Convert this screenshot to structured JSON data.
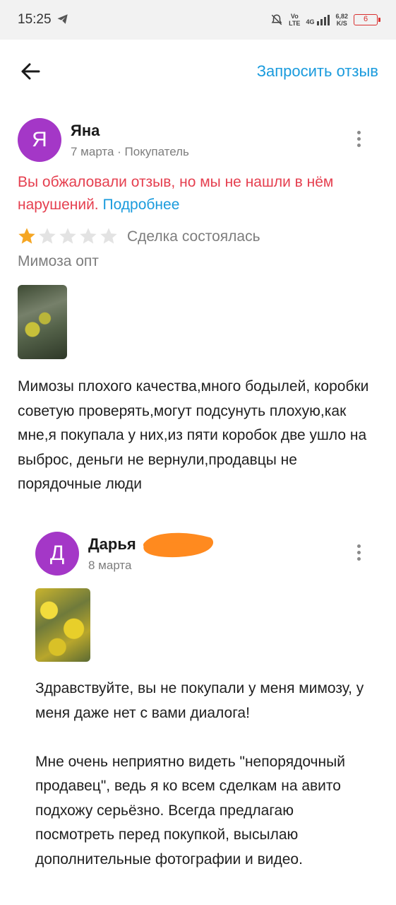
{
  "status_bar": {
    "time": "15:25",
    "icons": [
      "telegram-icon",
      "mute-icon",
      "volte-icon",
      "4g-signal-icon"
    ],
    "volte_label": [
      "Vo",
      "LTE"
    ],
    "network": "4G",
    "speed_value": "6,82",
    "speed_unit": "K/S",
    "battery": "6",
    "battery_color": "#d9302f"
  },
  "header": {
    "back_icon": "arrow-left-icon",
    "request_review": "Запросить отзыв"
  },
  "review": {
    "avatar_letter": "Я",
    "avatar_color": "#a437c7",
    "author": "Яна",
    "meta": "7 марта · Покупатель",
    "menu_icon": "more-vert-icon",
    "warning": "Вы обжаловали отзыв, но мы не нашли в нём нарушений.",
    "more_link": "Подробнее",
    "rating": 1,
    "rating_max": 5,
    "deal_status": "Сделка состоялась",
    "product": "Мимоза опт",
    "text": "Мимозы плохого качества,много бодылей, коробки советую проверять,могут подсунуть плохую,как мне,я покупала у них,из пяти коробок две ушло на выброс, деньги не вернули,продавцы не порядочные люди"
  },
  "reply": {
    "avatar_letter": "Д",
    "avatar_color": "#a437c7",
    "author": "Дарья",
    "date": "8 марта",
    "menu_icon": "more-vert-icon",
    "paragraphs": [
      "Здравствуйте, вы не покупали у меня мимозу, у меня даже нет с вами диалога!",
      "Мне очень неприятно видеть \"непорядочный продавец\", ведь я ко всем сделкам на авито подхожу серьёзно. Всегда предлагаю посмотреть перед покупкой, высылаю дополнительные фотографии и видео."
    ]
  },
  "colors": {
    "accent": "#1a9bdd",
    "warning": "#e53f4f",
    "star_filled": "#f5a623",
    "star_empty": "#e3e3e3",
    "scribble": "#ff8a1f"
  }
}
